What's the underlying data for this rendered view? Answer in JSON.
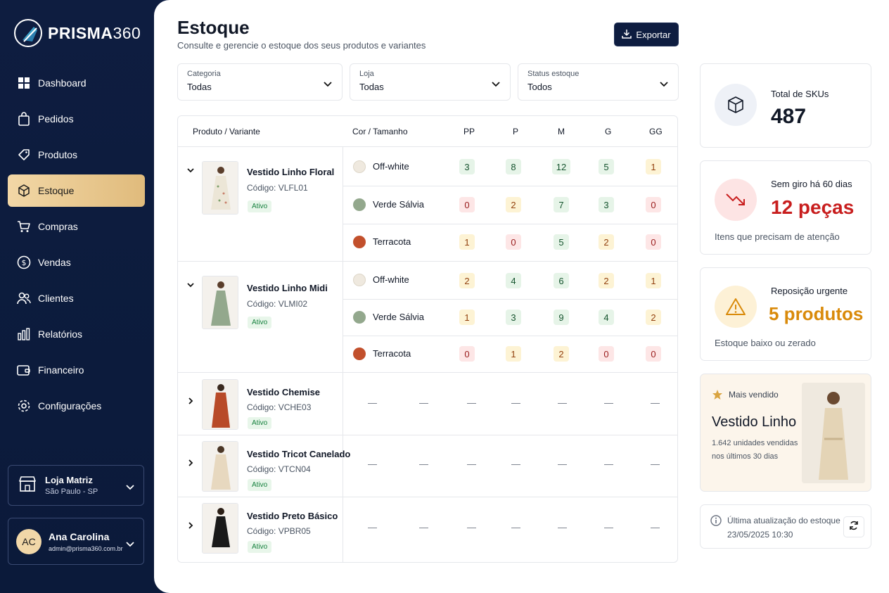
{
  "brand": {
    "name_main": "PRISMA",
    "name_num": "360"
  },
  "sidebar": {
    "items": [
      {
        "label": "Dashboard",
        "icon": "dashboard-icon"
      },
      {
        "label": "Pedidos",
        "icon": "bag-icon"
      },
      {
        "label": "Produtos",
        "icon": "tag-icon"
      },
      {
        "label": "Estoque",
        "icon": "box-icon",
        "active": true
      },
      {
        "label": "Compras",
        "icon": "cart-icon"
      },
      {
        "label": "Vendas",
        "icon": "dollar-icon"
      },
      {
        "label": "Clientes",
        "icon": "users-icon"
      },
      {
        "label": "Relatórios",
        "icon": "bar-chart-icon"
      },
      {
        "label": "Financeiro",
        "icon": "wallet-icon"
      },
      {
        "label": "Configurações",
        "icon": "gear-icon"
      }
    ],
    "store": {
      "name": "Loja Matriz",
      "location": "São Paulo - SP"
    },
    "user": {
      "initials": "AC",
      "name": "Ana Carolina",
      "email": "admin@prisma360.com.br"
    }
  },
  "header": {
    "title": "Estoque",
    "subtitle": "Consulte e gerencie o estoque dos seus produtos e variantes",
    "export_label": "Exportar"
  },
  "filters": [
    {
      "label": "Categoria",
      "value": "Todas"
    },
    {
      "label": "Loja",
      "value": "Todas"
    },
    {
      "label": "Status estoque",
      "value": "Todos"
    }
  ],
  "table": {
    "columns": {
      "product": "Produto / Variante",
      "color_size": "Cor / Tamanho",
      "sizes": [
        "PP",
        "P",
        "M",
        "G",
        "GG"
      ]
    },
    "products": [
      {
        "name": "Vestido Linho Floral",
        "code": "Código: VLFL01",
        "status": "Ativo",
        "expanded": true,
        "variants": [
          {
            "color": "Off-white",
            "swatch": "#efe9df",
            "values": [
              "3",
              "8",
              "12",
              "5",
              "1"
            ],
            "levels": [
              "g",
              "g",
              "g",
              "g",
              "y"
            ]
          },
          {
            "color": "Verde Sálvia",
            "swatch": "#93a88d",
            "values": [
              "0",
              "2",
              "7",
              "3",
              "0"
            ],
            "levels": [
              "r",
              "y",
              "g",
              "g",
              "r"
            ]
          },
          {
            "color": "Terracota",
            "swatch": "#c2502c",
            "values": [
              "1",
              "0",
              "5",
              "2",
              "0"
            ],
            "levels": [
              "y",
              "r",
              "g",
              "y",
              "r"
            ]
          }
        ]
      },
      {
        "name": "Vestido Linho Midi",
        "code": "Código: VLMI02",
        "status": "Ativo",
        "expanded": true,
        "variants": [
          {
            "color": "Off-white",
            "swatch": "#efe9df",
            "values": [
              "2",
              "4",
              "6",
              "2",
              "1"
            ],
            "levels": [
              "y",
              "g",
              "g",
              "y",
              "y"
            ]
          },
          {
            "color": "Verde Sálvia",
            "swatch": "#93a88d",
            "values": [
              "1",
              "3",
              "9",
              "4",
              "2"
            ],
            "levels": [
              "y",
              "g",
              "g",
              "g",
              "y"
            ]
          },
          {
            "color": "Terracota",
            "swatch": "#c2502c",
            "values": [
              "0",
              "1",
              "2",
              "0",
              "0"
            ],
            "levels": [
              "r",
              "y",
              "y",
              "r",
              "r"
            ]
          }
        ]
      },
      {
        "name": "Vestido Chemise",
        "code": "Código: VCHE03",
        "status": "Ativo",
        "expanded": false
      },
      {
        "name": "Vestido Tricot Canelado",
        "code": "Código: VTCN04",
        "status": "Ativo",
        "expanded": false
      },
      {
        "name": "Vestido Preto Básico",
        "code": "Código: VPBR05",
        "status": "Ativo",
        "expanded": false
      }
    ],
    "empty_cell": "—"
  },
  "cards": {
    "skus": {
      "title": "Total de SKUs",
      "value": "487"
    },
    "no_turnover": {
      "title": "Sem giro há 60 dias",
      "value": "12 peças",
      "note": "Itens que precisam de atenção"
    },
    "restock": {
      "title": "Reposição urgente",
      "value": "5 produtos",
      "note": "Estoque baixo ou zerado"
    },
    "best_seller": {
      "tag": "Mais vendido",
      "name": "Vestido Linho",
      "line1": "1.642 unidades vendidas",
      "line2": "nos últimos 30 dias"
    },
    "updated": {
      "label": "Última atualização do estoque",
      "datetime": "23/05/2025 10:30"
    }
  },
  "colors": {
    "navy": "#0e1d40",
    "gold": "#e0bb7c",
    "red": "#c81e1e",
    "amber": "#d98a0a"
  }
}
